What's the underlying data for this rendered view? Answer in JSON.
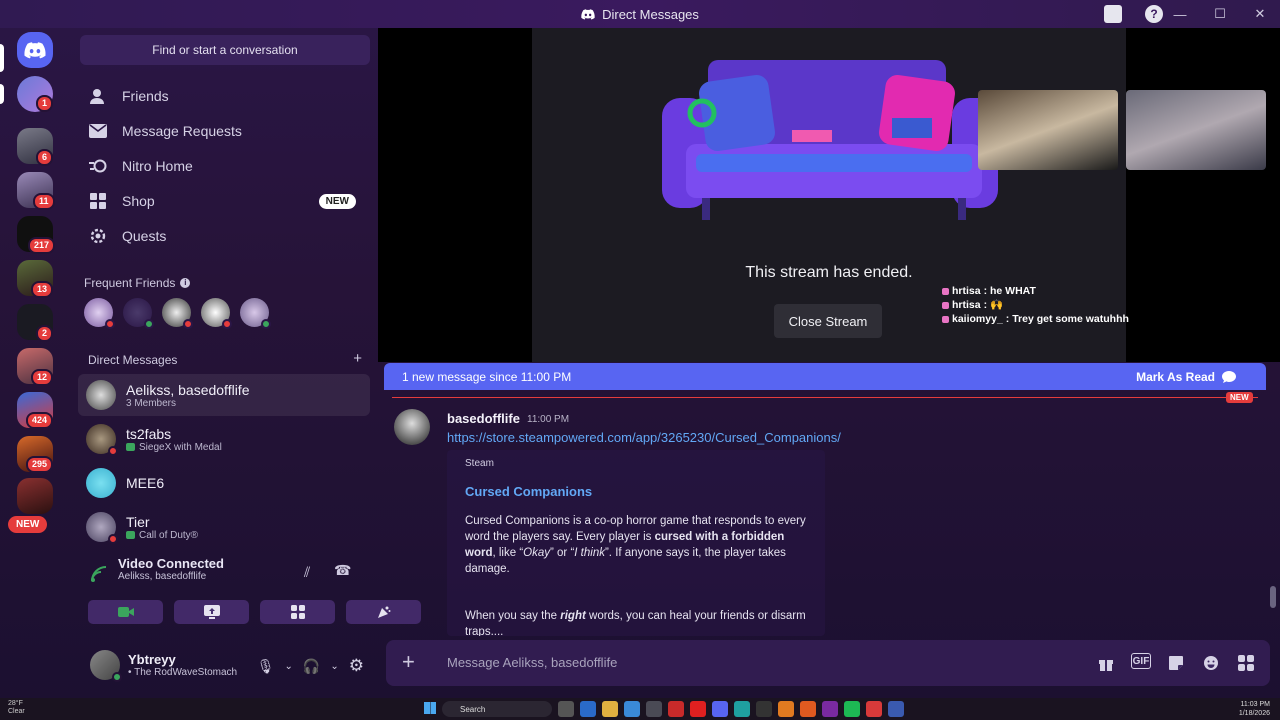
{
  "window": {
    "title": "Direct Messages"
  },
  "servers": {
    "badges": [
      "1",
      "6",
      "11",
      "217",
      "13",
      "2",
      "12",
      "424",
      "295"
    ],
    "new_pill": "NEW"
  },
  "dm_column": {
    "search_label": "Find or start a conversation",
    "nav": [
      {
        "label": "Friends",
        "icon": "friends-icon"
      },
      {
        "label": "Message Requests",
        "icon": "mail-icon"
      },
      {
        "label": "Nitro Home",
        "icon": "nitro-icon"
      },
      {
        "label": "Shop",
        "icon": "shop-icon",
        "badge": "NEW"
      },
      {
        "label": "Quests",
        "icon": "quests-icon"
      }
    ],
    "frequent_friends_label": "Frequent Friends",
    "direct_messages_label": "Direct Messages",
    "add_symbol": "+",
    "dms": [
      {
        "name": "Aelikss, basedofflife",
        "sub": "3 Members"
      },
      {
        "name": "ts2fabs",
        "sub": "SiegeX with Medal"
      },
      {
        "name": "MEE6",
        "sub": ""
      },
      {
        "name": "Tier",
        "sub": "Call of Duty®"
      }
    ]
  },
  "voice": {
    "status": "Video Connected",
    "channel": "Aelikss, basedofflife"
  },
  "user": {
    "name": "Ybtreyy",
    "status": "• The RodWaveStomach"
  },
  "stream": {
    "ended_text": "This stream has ended.",
    "close_label": "Close Stream",
    "chat": [
      {
        "user": "hrtisa",
        "text": ": he WHAT"
      },
      {
        "user": "hrtisa",
        "text": ": 🙌"
      },
      {
        "user": "kaiiomyy_",
        "text": ": Trey get some watuhhh"
      }
    ]
  },
  "new_messages": {
    "text": "1 new message since 11:00 PM",
    "mark_read": "Mark As Read",
    "tag": "NEW"
  },
  "message": {
    "author": "basedofflife",
    "time": "11:00 PM",
    "link": "https://store.steampowered.com/app/3265230/Cursed_Companions/",
    "embed": {
      "provider": "Steam",
      "title": "Cursed Companions",
      "desc_a": "Cursed Companions is a co-op horror game that responds to every word the players say. Every player is ",
      "desc_b": "cursed with a forbidden word",
      "desc_c": ", like “",
      "desc_d": "Okay",
      "desc_e": "” or “",
      "desc_f": "I think",
      "desc_g": "”. If anyone says it, the player takes damage.",
      "desc2_a": "When you say the ",
      "desc2_b": "right",
      "desc2_c": " words, you can heal your friends or disarm traps...."
    }
  },
  "composer": {
    "placeholder": "Message Aelikss, basedofflife",
    "gif_label": "GIF"
  },
  "taskbar": {
    "weather_temp": "28°F",
    "weather_desc": "Clear",
    "search": "Search",
    "time": "11:03 PM",
    "date": "1/18/2026"
  },
  "colors": {
    "blurple": "#5865f2",
    "red": "#e53c3c",
    "green": "#3ba55d",
    "link": "#62a8f5"
  }
}
